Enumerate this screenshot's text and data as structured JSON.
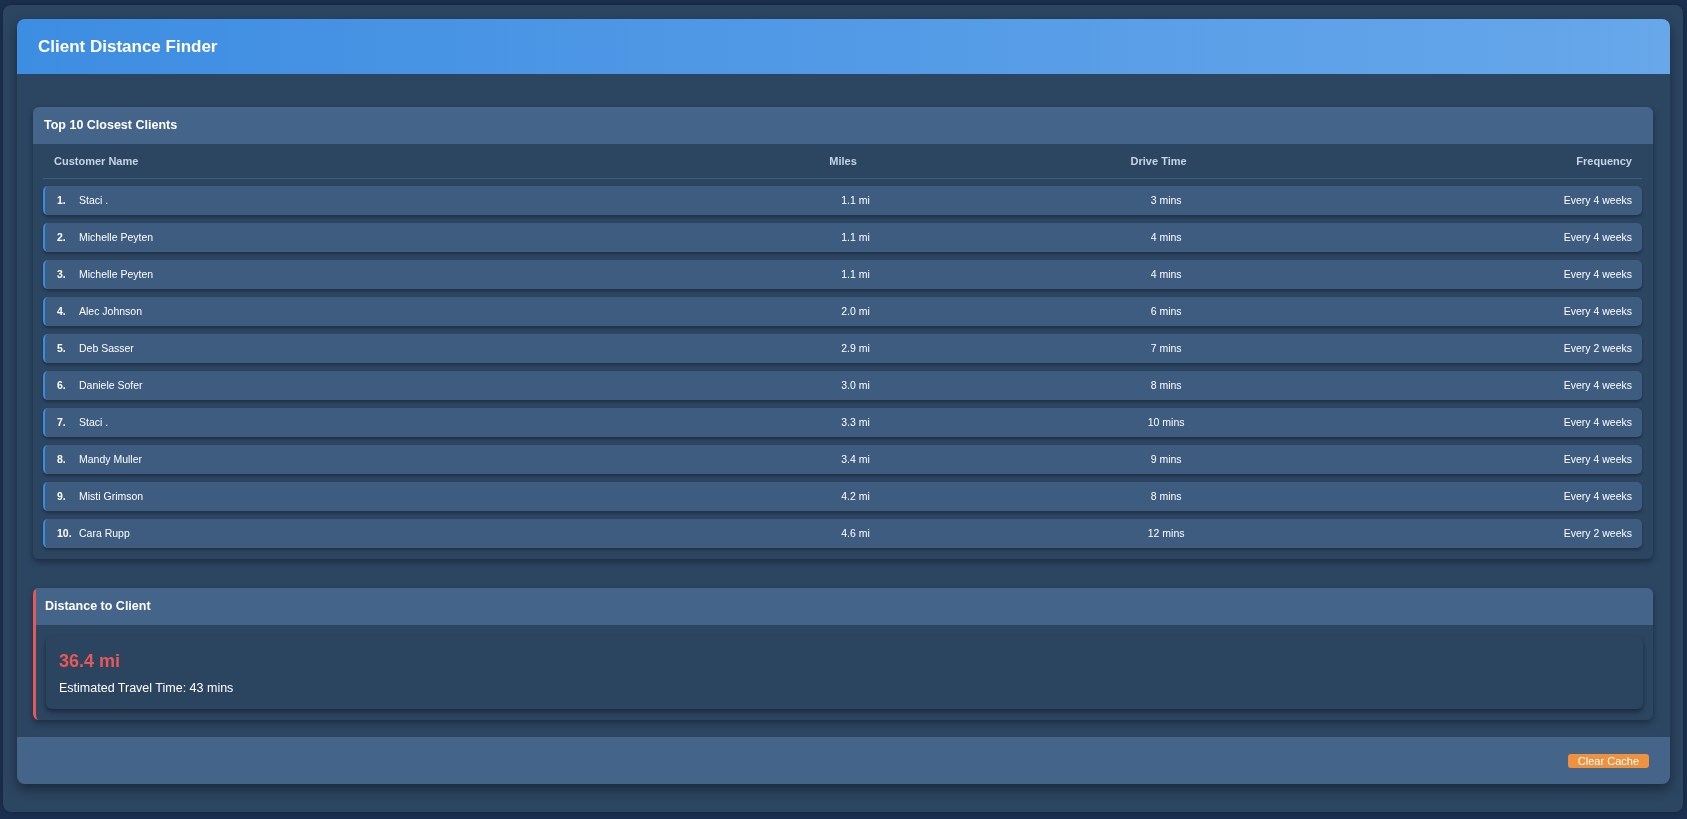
{
  "app": {
    "title": "Client Distance Finder"
  },
  "closest_clients": {
    "title": "Top 10 Closest Clients",
    "columns": [
      "Customer Name",
      "Miles",
      "Drive Time",
      "Frequency"
    ],
    "rows": [
      {
        "rank": "1.",
        "name": "Staci .",
        "miles": "1.1 mi",
        "drive_time": "3 mins",
        "frequency": "Every 4 weeks"
      },
      {
        "rank": "2.",
        "name": "Michelle Peyten",
        "miles": "1.1 mi",
        "drive_time": "4 mins",
        "frequency": "Every 4 weeks"
      },
      {
        "rank": "3.",
        "name": "Michelle Peyten",
        "miles": "1.1 mi",
        "drive_time": "4 mins",
        "frequency": "Every 4 weeks"
      },
      {
        "rank": "4.",
        "name": "Alec Johnson",
        "miles": "2.0 mi",
        "drive_time": "6 mins",
        "frequency": "Every 4 weeks"
      },
      {
        "rank": "5.",
        "name": "Deb Sasser",
        "miles": "2.9 mi",
        "drive_time": "7 mins",
        "frequency": "Every 2 weeks"
      },
      {
        "rank": "6.",
        "name": "Daniele Sofer",
        "miles": "3.0 mi",
        "drive_time": "8 mins",
        "frequency": "Every 4 weeks"
      },
      {
        "rank": "7.",
        "name": "Staci .",
        "miles": "3.3 mi",
        "drive_time": "10 mins",
        "frequency": "Every 4 weeks"
      },
      {
        "rank": "8.",
        "name": "Mandy Muller",
        "miles": "3.4 mi",
        "drive_time": "9 mins",
        "frequency": "Every 4 weeks"
      },
      {
        "rank": "9.",
        "name": "Misti Grimson",
        "miles": "4.2 mi",
        "drive_time": "8 mins",
        "frequency": "Every 4 weeks"
      },
      {
        "rank": "10.",
        "name": "Cara Rupp",
        "miles": "4.6 mi",
        "drive_time": "12 mins",
        "frequency": "Every 2 weeks"
      }
    ]
  },
  "distance": {
    "title": "Distance to Client",
    "value": "36.4 mi",
    "travel_time": "Estimated Travel Time: 43 mins"
  },
  "footer": {
    "buttons": [
      "Clear Cache"
    ]
  }
}
